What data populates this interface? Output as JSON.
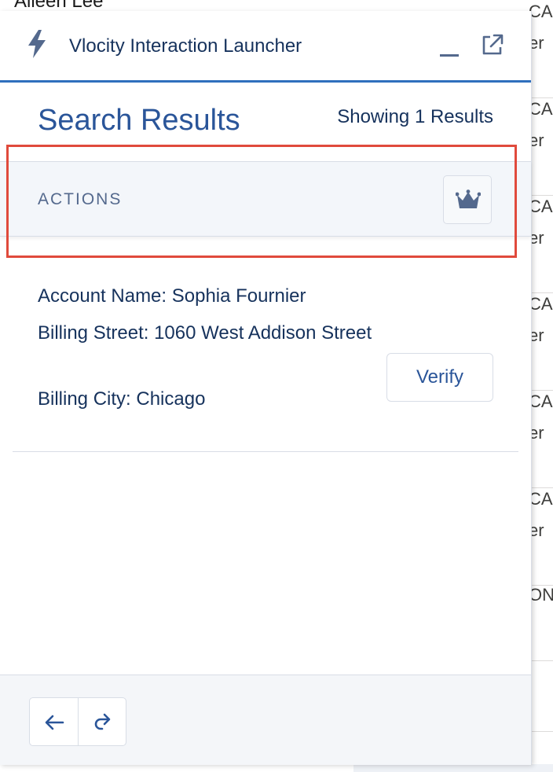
{
  "background": {
    "top_name_partial": "Aileen Lee",
    "rows": [
      {
        "line1": "CA",
        "line2": "er"
      },
      {
        "line1": "CA",
        "line2": "er"
      },
      {
        "line1": "CA",
        "line2": "er"
      },
      {
        "line1": "CA",
        "line2": "er"
      },
      {
        "line1": "CA",
        "line2": "er"
      },
      {
        "line1": "CA",
        "line2": "er"
      },
      {
        "line1": "ON",
        "line2": ""
      },
      {
        "line1": "",
        "line2": ""
      }
    ]
  },
  "header": {
    "title": "Vlocity Interaction Launcher",
    "icon": "lightning-bolt-icon"
  },
  "results": {
    "title": "Search Results",
    "count_text": "Showing 1 Results"
  },
  "actions": {
    "label": "ACTIONS",
    "icon": "crown-icon"
  },
  "result_card": {
    "account_name": "Account Name: Sophia Fournier",
    "billing_street": "Billing Street: 1060 West Addison Street",
    "billing_city": "Billing City: Chicago",
    "verify_label": "Verify"
  },
  "footer": {
    "back_icon": "arrow-left-icon",
    "forward_icon": "redo-icon"
  },
  "colors": {
    "accent": "#2f6fbd",
    "highlight": "#e04a3c",
    "text": "#16325c"
  }
}
